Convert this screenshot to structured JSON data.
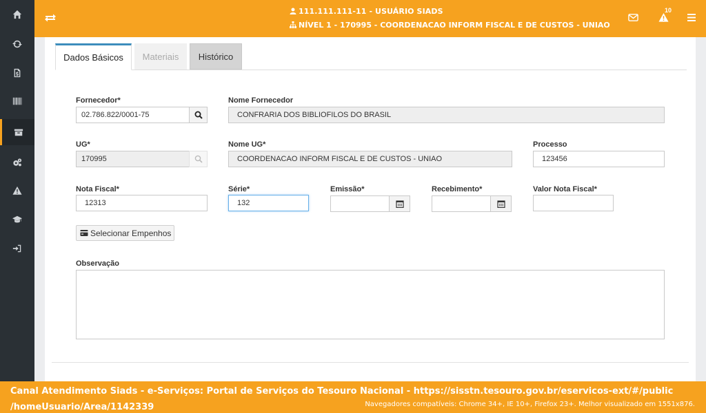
{
  "header": {
    "user": "111.111.111-11 - USUÁRIO SIADS",
    "level": "NÍVEL 1 - 170995 - COORDENACAO INFORM FISCAL E DE CUSTOS - UNIAO",
    "notification_count": "10"
  },
  "sidebar": {
    "items": [
      {
        "icon": "home-icon"
      },
      {
        "icon": "refresh-icon"
      },
      {
        "icon": "document-money-icon"
      },
      {
        "icon": "barcode-icon"
      },
      {
        "icon": "archive-icon",
        "active": true
      },
      {
        "icon": "gears-icon"
      },
      {
        "icon": "warning-icon"
      },
      {
        "icon": "graduation-cap-icon"
      },
      {
        "icon": "sign-in-icon"
      }
    ]
  },
  "tabs": [
    {
      "label": "Dados Básicos",
      "state": "active"
    },
    {
      "label": "Materiais",
      "state": "disabled"
    },
    {
      "label": "Histórico",
      "state": "default"
    }
  ],
  "form": {
    "fornecedor": {
      "label": "Fornecedor*",
      "value": "02.786.822/0001-75"
    },
    "nome_fornecedor": {
      "label": "Nome Fornecedor",
      "value": "CONFRARIA DOS BIBLIOFILOS DO BRASIL"
    },
    "ug": {
      "label": "UG*",
      "value": "170995"
    },
    "nome_ug": {
      "label": "Nome UG*",
      "value": "COORDENACAO INFORM FISCAL E DE CUSTOS - UNIAO"
    },
    "processo": {
      "label": "Processo",
      "value": "123456"
    },
    "nota_fiscal": {
      "label": "Nota Fiscal*",
      "value": "12313"
    },
    "serie": {
      "label": "Série*",
      "value": "132"
    },
    "emissao": {
      "label": "Emissão*",
      "value": ""
    },
    "recebimento": {
      "label": "Recebimento*",
      "value": ""
    },
    "valor_nota_fiscal": {
      "label": "Valor Nota Fiscal*",
      "value": ""
    },
    "selecionar_empenhos": "Selecionar Empenhos",
    "observacao": {
      "label": "Observação",
      "value": ""
    }
  },
  "footer": {
    "main": "Canal Atendimento Siads - e-Serviços: Portal de Serviços do Tesouro Nacional - https://sisstn.tesouro.gov.br/eservicos-ext/#/public /homeUsuario/Area/1142339",
    "compat": "Navegadores compatíveis: Chrome 34+, IE 10+, Firefox 23+. Melhor visualizado em 1551x876."
  },
  "colors": {
    "accent": "#f6a21f",
    "sidebar": "#2a3035",
    "tab_active_border": "#3c8dbc"
  }
}
